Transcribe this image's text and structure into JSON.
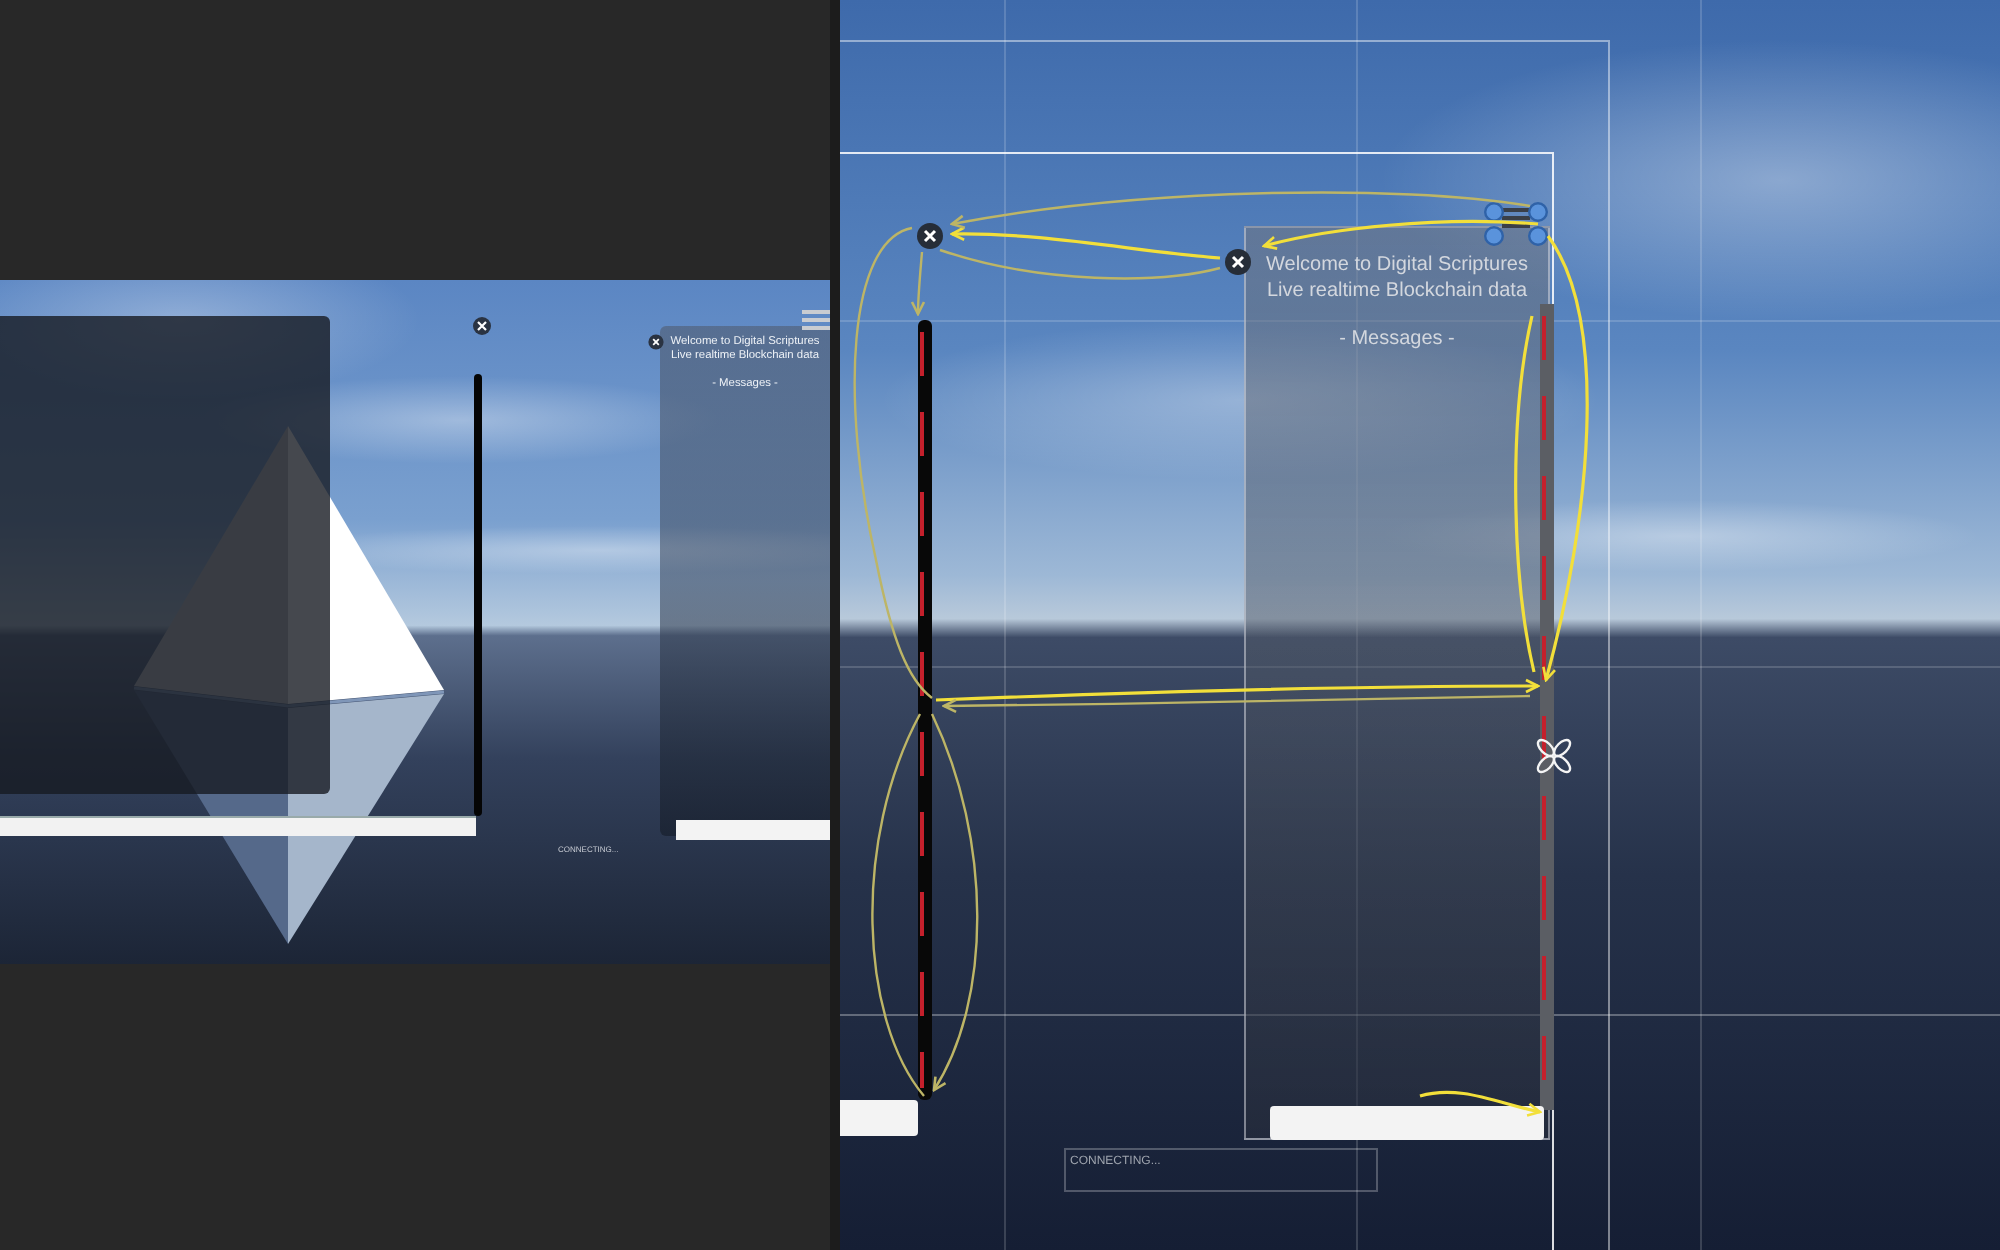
{
  "game_view": {
    "chat_panel": {
      "title": "Welcome to Digital Scriptures",
      "subtitle": "Live realtime Blockchain data",
      "header": "- Messages -"
    },
    "status": "CONNECTING..."
  },
  "scene_view": {
    "chat_panel": {
      "title": "Welcome to Digital Scriptures",
      "subtitle": "Live realtime Blockchain data",
      "header": "- Messages -"
    },
    "status": "CONNECTING..."
  }
}
